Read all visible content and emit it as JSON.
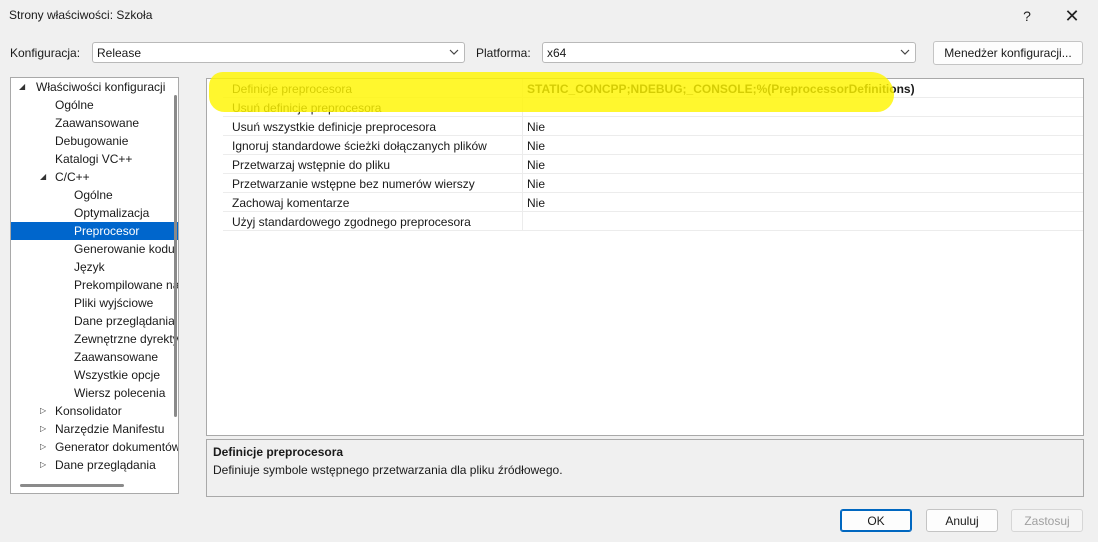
{
  "window": {
    "title": "Strony właściwości: Szkoła",
    "help_icon": "?",
    "close_icon": "✕"
  },
  "toolbar": {
    "config_label": "Konfiguracja:",
    "config_value": "Release",
    "platform_label": "Platforma:",
    "platform_value": "x64",
    "manager_button": "Menedżer konfiguracji..."
  },
  "tree": {
    "items": [
      {
        "label": "Właściwości konfiguracji",
        "arrow": "◢",
        "level": 0
      },
      {
        "label": "Ogólne",
        "arrow": "",
        "level": 1
      },
      {
        "label": "Zaawansowane",
        "arrow": "",
        "level": 1
      },
      {
        "label": "Debugowanie",
        "arrow": "",
        "level": 1
      },
      {
        "label": "Katalogi VC++",
        "arrow": "",
        "level": 1
      },
      {
        "label": "C/C++",
        "arrow": "◢",
        "level": 1
      },
      {
        "label": "Ogólne",
        "arrow": "",
        "level": 2
      },
      {
        "label": "Optymalizacja",
        "arrow": "",
        "level": 2
      },
      {
        "label": "Preprocesor",
        "arrow": "",
        "level": 2,
        "selected": true
      },
      {
        "label": "Generowanie kodu",
        "arrow": "",
        "level": 2
      },
      {
        "label": "Język",
        "arrow": "",
        "level": 2
      },
      {
        "label": "Prekompilowane na",
        "arrow": "",
        "level": 2
      },
      {
        "label": "Pliki wyjściowe",
        "arrow": "",
        "level": 2
      },
      {
        "label": "Dane przeglądania",
        "arrow": "",
        "level": 2
      },
      {
        "label": "Zewnętrzne dyrekty",
        "arrow": "",
        "level": 2
      },
      {
        "label": "Zaawansowane",
        "arrow": "",
        "level": 2
      },
      {
        "label": "Wszystkie opcje",
        "arrow": "",
        "level": 2
      },
      {
        "label": "Wiersz polecenia",
        "arrow": "",
        "level": 2
      },
      {
        "label": "Konsolidator",
        "arrow": "▷",
        "level": 1
      },
      {
        "label": "Narzędzie Manifestu",
        "arrow": "▷",
        "level": 1
      },
      {
        "label": "Generator dokumentów",
        "arrow": "▷",
        "level": 1
      },
      {
        "label": "Dane przeglądania",
        "arrow": "▷",
        "level": 1
      }
    ]
  },
  "properties": [
    {
      "name": "Definicje preprocesora",
      "value": "STATIC_CONCPP;NDEBUG;_CONSOLE;%(PreprocessorDefinitions)"
    },
    {
      "name": "Usuń definicje preprocesora",
      "value": ""
    },
    {
      "name": "Usuń wszystkie definicje preprocesora",
      "value": "Nie"
    },
    {
      "name": "Ignoruj standardowe ścieżki dołączanych plików",
      "value": "Nie"
    },
    {
      "name": "Przetwarzaj wstępnie do pliku",
      "value": "Nie"
    },
    {
      "name": "Przetwarzanie wstępne bez numerów wierszy",
      "value": "Nie"
    },
    {
      "name": "Zachowaj komentarze",
      "value": "Nie"
    },
    {
      "name": "Użyj standardowego zgodnego preprocesora",
      "value": ""
    }
  ],
  "description": {
    "title": "Definicje preprocesora",
    "text": "Definiuje symbole wstępnego przetwarzania dla pliku źródłowego."
  },
  "buttons": {
    "ok": "OK",
    "cancel": "Anuluj",
    "apply": "Zastosuj"
  },
  "colors": {
    "selection": "#0066cc",
    "highlight": "#fff500"
  }
}
